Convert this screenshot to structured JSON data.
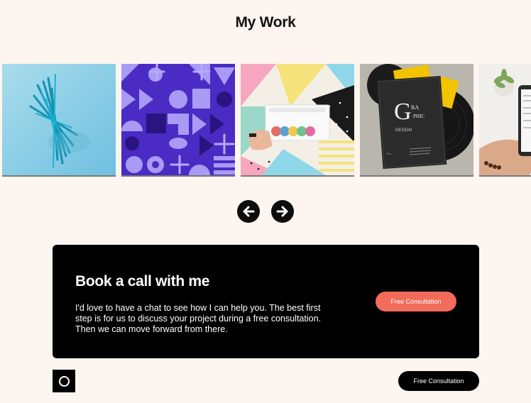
{
  "section": {
    "title": "My Work"
  },
  "gallery": {
    "items": [
      {
        "image": "teal-glass-sculpture"
      },
      {
        "image": "purple-geometric-pattern"
      },
      {
        "image": "hand-holding-card-colorful-shapes"
      },
      {
        "image": "graphic-design-book-vinyl-records"
      },
      {
        "image": "hand-holding-phone-plant"
      }
    ],
    "prev_icon": "arrow-left-icon",
    "next_icon": "arrow-right-icon"
  },
  "cta_card": {
    "heading": "Book a call with me",
    "body": "I'd love to have a chat to see how I can help you. The best first step is for us to discuss your project during a free consultation. Then we can move forward from there.",
    "button_label": "Free Consultation"
  },
  "footer": {
    "logo_icon": "circle-logo-icon",
    "button_label": "Free Consultation"
  },
  "colors": {
    "background": "#fdf5ef",
    "card": "#000000",
    "accent": "#f26b5b"
  }
}
